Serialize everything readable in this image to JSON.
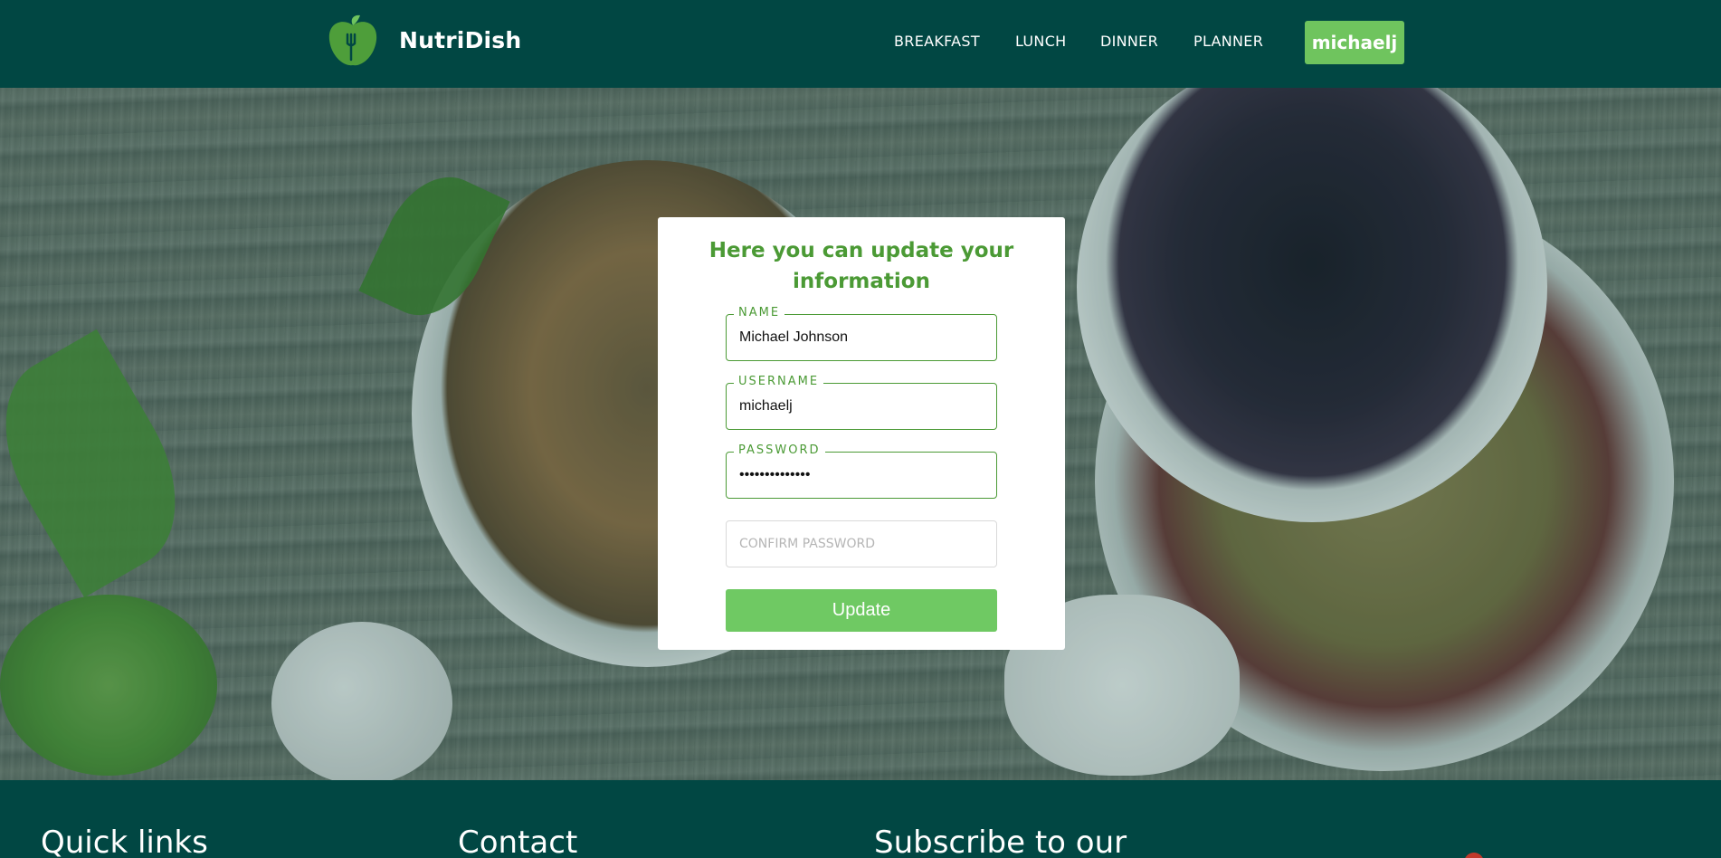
{
  "header": {
    "brand": "NutriDish",
    "logo_icon": "apple-fork-icon",
    "nav": [
      {
        "label": "BREAKFAST"
      },
      {
        "label": "LUNCH"
      },
      {
        "label": "DINNER"
      },
      {
        "label": "PLANNER"
      }
    ],
    "user_button": "michaelj",
    "colors": {
      "header_bg": "#014743",
      "accent": "#6fc45e"
    }
  },
  "form": {
    "title": "Here you can update your information",
    "fields": [
      {
        "label": "NAME",
        "value": "Michael Johnson"
      },
      {
        "label": "USERNAME",
        "value": "michaelj"
      },
      {
        "label": "PASSWORD",
        "value": "••••••••••••••"
      },
      {
        "label": "",
        "placeholder": "CONFIRM PASSWORD",
        "value": ""
      }
    ],
    "submit_label": "Update",
    "colors": {
      "title": "#4b9a35",
      "button": "#6fc963"
    }
  },
  "footer": {
    "headings": [
      "Quick links",
      "Contact",
      "Subscribe to our"
    ]
  }
}
